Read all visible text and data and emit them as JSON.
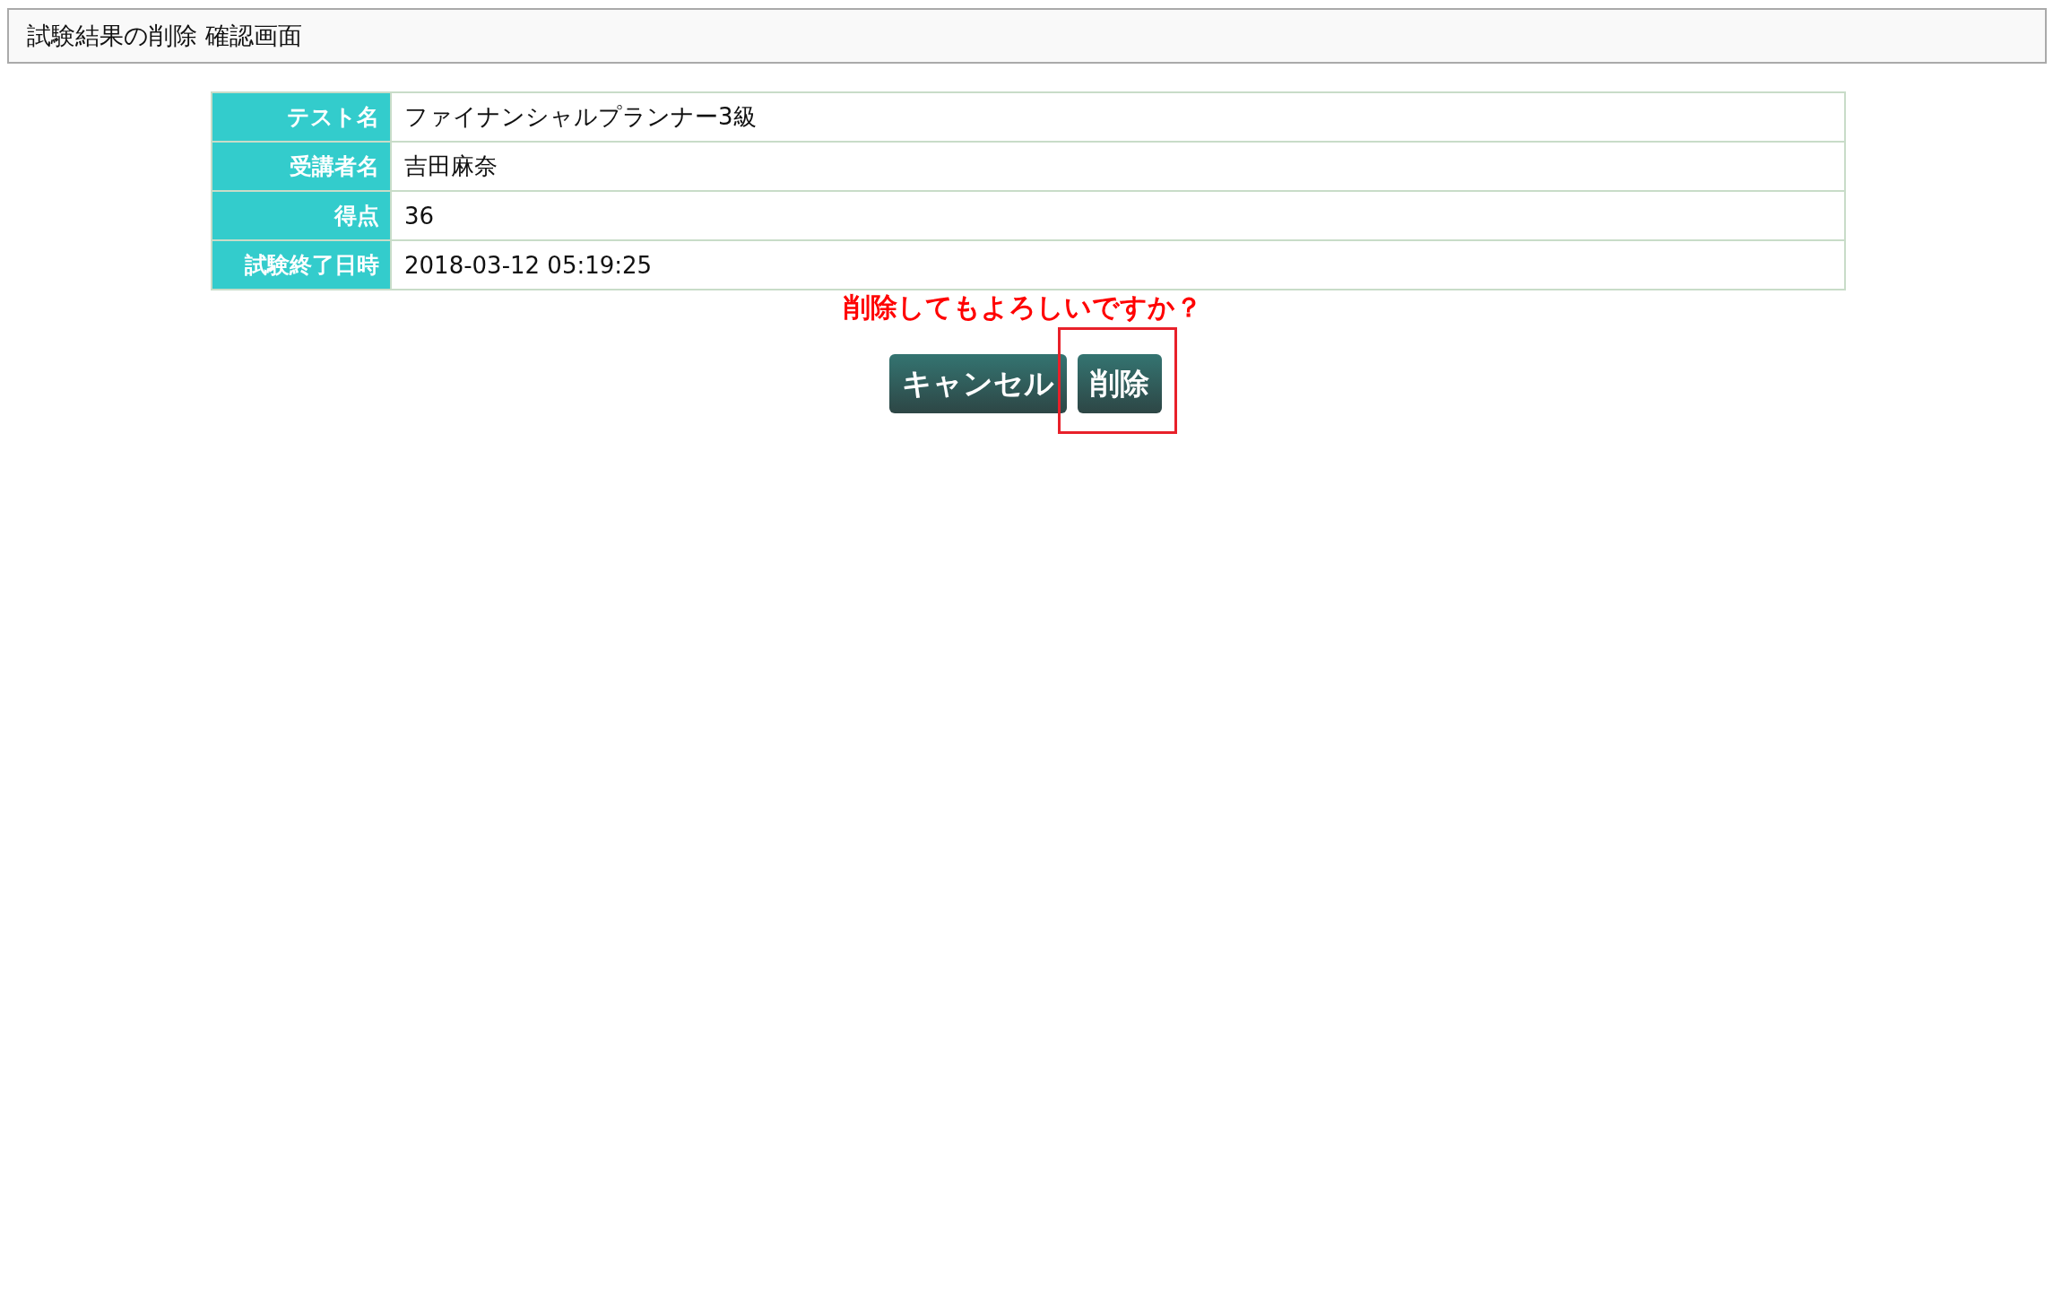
{
  "header": {
    "title": "試験結果の削除 確認画面"
  },
  "details": [
    {
      "label": "テスト名",
      "value": "ファイナンシャルプランナー3級"
    },
    {
      "label": "受講者名",
      "value": "吉田麻奈"
    },
    {
      "label": "得点",
      "value": "36"
    },
    {
      "label": "試験終了日時",
      "value": "2018-03-12 05:19:25"
    }
  ],
  "confirm_message": "削除してもよろしいですか？",
  "buttons": [
    {
      "label": "キャンセル",
      "highlighted": false
    },
    {
      "label": "削除",
      "highlighted": true
    }
  ]
}
